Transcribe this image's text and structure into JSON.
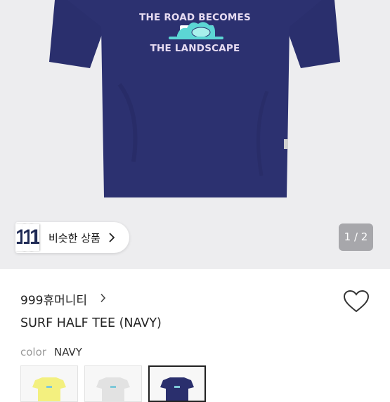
{
  "product_image": {
    "print_top": "THE ROAD BECOMES",
    "print_bottom": "THE LANDSCAPE",
    "tee_color": "#2a2f6d",
    "wave_color": "#5cd6d4"
  },
  "similar_products": {
    "label": "비슷한 상품",
    "thumb_glyph": "1"
  },
  "gallery": {
    "counter": "1 / 2"
  },
  "store": {
    "name": "999휴머니티"
  },
  "product": {
    "title": "SURF HALF TEE (NAVY)"
  },
  "color_option": {
    "label": "color",
    "selected": "NAVY",
    "swatches": [
      {
        "color": "#f3f07f",
        "selected": false
      },
      {
        "color": "#e6e6e6",
        "selected": false
      },
      {
        "color": "#2a2f6d",
        "selected": true
      }
    ]
  }
}
